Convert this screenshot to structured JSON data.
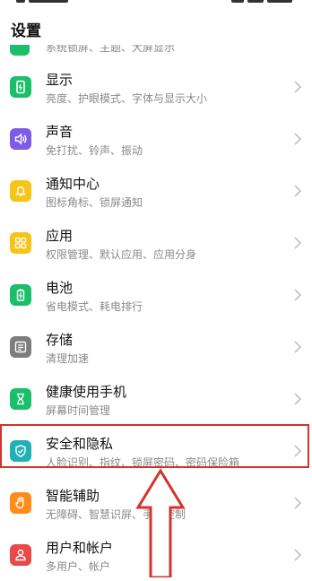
{
  "page": {
    "title": "设置"
  },
  "partial_item": {
    "subtitle": "系统锁屏、主题、大屏显示"
  },
  "items": [
    {
      "title": "显示",
      "subtitle": "亮度、护眼模式、字体与显示大小",
      "icon": "display-icon",
      "color": "#1bbf6a"
    },
    {
      "title": "声音",
      "subtitle": "免打扰、铃声、振动",
      "icon": "sound-icon",
      "color": "#7c5ce6"
    },
    {
      "title": "通知中心",
      "subtitle": "图标角标、锁屏通知",
      "icon": "bell-icon",
      "color": "#f5c518"
    },
    {
      "title": "应用",
      "subtitle": "权限管理、默认应用、应用分身",
      "icon": "apps-grid-icon",
      "color": "#f5c518"
    },
    {
      "title": "电池",
      "subtitle": "省电模式、耗电排行",
      "icon": "battery-icon",
      "color": "#1bbf6a"
    },
    {
      "title": "存储",
      "subtitle": "清理加速",
      "icon": "storage-icon",
      "color": "#7d7d7d"
    },
    {
      "title": "健康使用手机",
      "subtitle": "屏幕时间管理",
      "icon": "hourglass-icon",
      "color": "#1bbf6a"
    },
    {
      "title": "安全和隐私",
      "subtitle": "人脸识别、指纹、锁屏密码、密码保险箱",
      "icon": "shield-icon",
      "color": "#21b0b6"
    },
    {
      "title": "智能辅助",
      "subtitle": "无障碍、智慧识屏、手势控制",
      "icon": "hand-icon",
      "color": "#ff8c1a"
    },
    {
      "title": "用户和帐户",
      "subtitle": "多用户、帐户",
      "icon": "user-icon",
      "color": "#e84a4a"
    }
  ],
  "annotation": {
    "highlight_color": "#d0342c"
  }
}
